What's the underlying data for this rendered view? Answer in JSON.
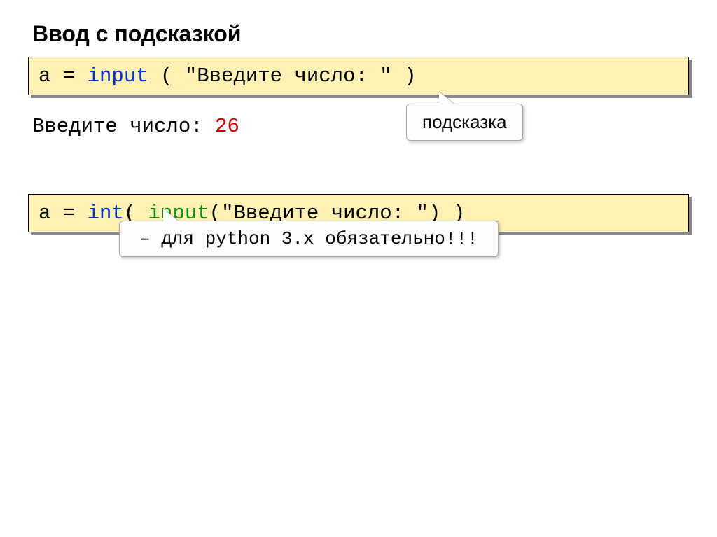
{
  "title": "Ввод с подсказкой",
  "code1": {
    "var": "a = ",
    "func": "input",
    "rest": " ( \"Введите число: \" )"
  },
  "output": {
    "label": "Введите число: ",
    "value": "26"
  },
  "hint1": "подсказка",
  "code2": {
    "var": "a = ",
    "int": "int",
    "paren_open": "( ",
    "input": "input",
    "args": "(\"Введите число: \")",
    "paren_close": " )"
  },
  "hint2": "– для python 3.x обязательно!!!"
}
